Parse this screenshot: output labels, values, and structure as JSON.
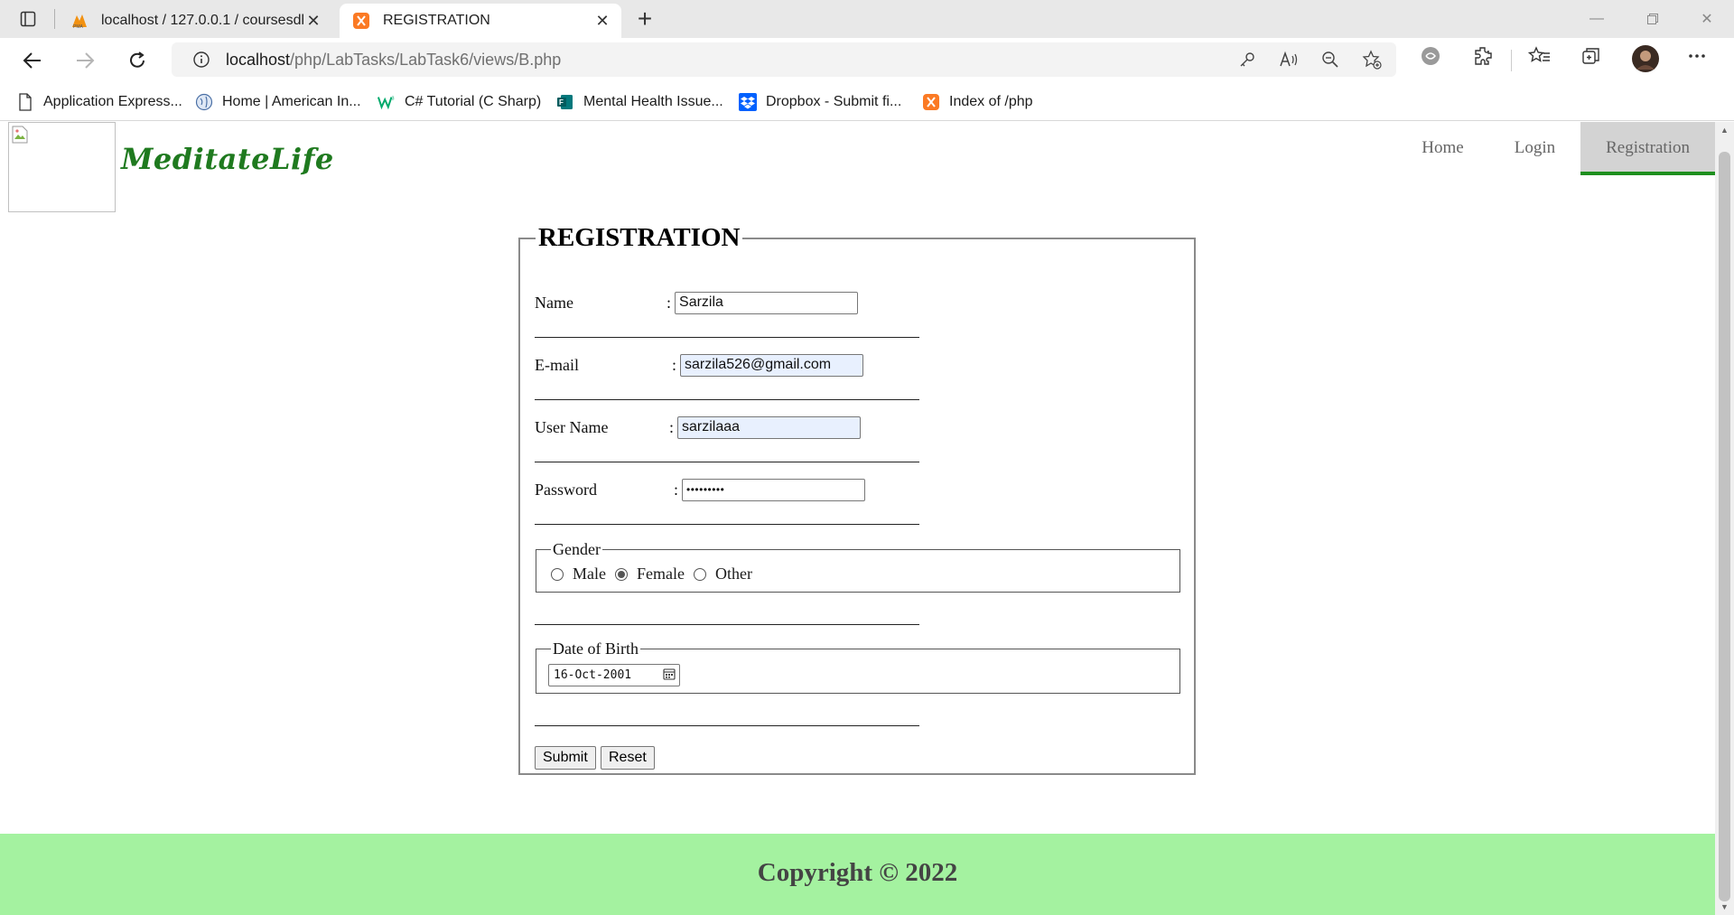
{
  "browser": {
    "tabs": [
      {
        "title": "localhost / 127.0.0.1 / coursesdb",
        "icon": "phpmyadmin-icon",
        "active": false
      },
      {
        "title": "REGISTRATION",
        "icon": "xampp-icon",
        "active": true
      }
    ],
    "address": {
      "host": "localhost",
      "path": "/php/LabTasks/LabTask6/views/B.php"
    },
    "bookmarks": [
      {
        "label": "Application Express...",
        "icon": "page-icon"
      },
      {
        "label": "Home | American In...",
        "icon": "globe-icon"
      },
      {
        "label": "C# Tutorial (C Sharp)",
        "icon": "w3schools-icon"
      },
      {
        "label": "Mental Health Issue...",
        "icon": "forms-icon"
      },
      {
        "label": "Dropbox - Submit fi...",
        "icon": "dropbox-icon"
      },
      {
        "label": "Index of /php",
        "icon": "xampp-icon"
      }
    ]
  },
  "site": {
    "brand": "MeditateLife",
    "nav": [
      {
        "label": "Home",
        "active": false
      },
      {
        "label": "Login",
        "active": false
      },
      {
        "label": "Registration",
        "active": true
      }
    ],
    "footer": "Copyright © 2022"
  },
  "form": {
    "legend": "REGISTRATION",
    "name": {
      "label": "Name",
      "value": "Sarzila"
    },
    "email": {
      "label": "E-mail",
      "value": "sarzila526@gmail.com"
    },
    "username": {
      "label": "User Name",
      "value": "sarzilaaa"
    },
    "password": {
      "label": "Password",
      "value": "•••••••••"
    },
    "gender": {
      "legend": "Gender",
      "options": [
        "Male",
        "Female",
        "Other"
      ],
      "selected": "Female"
    },
    "dob": {
      "legend": "Date of Birth",
      "value": "16-Oct-2001"
    },
    "submit_label": "Submit",
    "reset_label": "Reset"
  },
  "colors": {
    "brand": "#1f7a1f",
    "footer_bg": "#a4f2a0",
    "nav_active_bg": "#d3d3d3",
    "nav_active_border": "#1e8f1e"
  }
}
